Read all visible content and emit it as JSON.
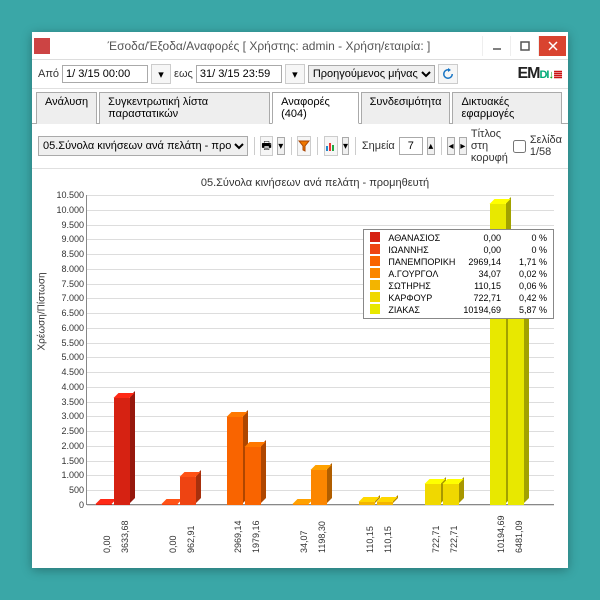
{
  "window": {
    "title": "Έσοδα/Έξοδα/Αναφορές   [ Χρήστης: admin - Χρήση/εταιρία:                                   ]"
  },
  "bar1": {
    "from_label": "Από",
    "from_value": "1/ 3/15 00:00",
    "to_label": "εως",
    "to_value": "31/ 3/15 23:59",
    "period": "Προηγούμενος μήνας"
  },
  "logo": {
    "text": "EMDI"
  },
  "tabs": [
    {
      "label": "Ανάλυση"
    },
    {
      "label": "Συγκεντρωτική λίστα παραστατικών"
    },
    {
      "label": "Αναφορές (404)",
      "active": true
    },
    {
      "label": "Συνδεσιμότητα"
    },
    {
      "label": "Δικτυακές εφαρμογές"
    }
  ],
  "bar2": {
    "report": "05.Σύνολα κινήσεων ανά πελάτη - προ",
    "points_label": "Σημεία",
    "points_value": "7",
    "title_top_label": "Τίτλος στη κορυφή",
    "page_label": "Σελίδα 1/58"
  },
  "chart_title": "05.Σύνολα κινήσεων ανά πελάτη - προμηθευτή",
  "y_axis_label": "Χρέωση/Πίστωση",
  "chart_data": {
    "type": "bar",
    "ylim": [
      0,
      10500
    ],
    "ystep": 500,
    "colors": [
      "#d62212",
      "#ee4412",
      "#f96400",
      "#fb8600",
      "#f3b400",
      "#f0d800",
      "#e8e800"
    ],
    "series": [
      {
        "a": 0.0,
        "b": 3633.68,
        "xa": "0,00",
        "xb": "3633,68"
      },
      {
        "a": 0.0,
        "b": 962.91,
        "xa": "0,00",
        "xb": "962,91"
      },
      {
        "a": 2969.14,
        "b": 1979.16,
        "xa": "2969,14",
        "xb": "1979,16"
      },
      {
        "a": 34.07,
        "b": 1198.3,
        "xa": "34,07",
        "xb": "1198,30"
      },
      {
        "a": 110.15,
        "b": 110.15,
        "xa": "110,15",
        "xb": "110,15"
      },
      {
        "a": 722.71,
        "b": 722.71,
        "xa": "722,71",
        "xb": "722,71"
      },
      {
        "a": 10194.69,
        "b": 6481.09,
        "xa": "10194,69",
        "xb": "6481,09"
      }
    ]
  },
  "legend": [
    {
      "name": "ΑΘΑΝΑΣΙΟΣ",
      "val": "0,00",
      "pct": "0 %"
    },
    {
      "name": "ΙΩΑΝΝΗΣ",
      "val": "0,00",
      "pct": "0 %"
    },
    {
      "name": "ΠΑΝΕΜΠΟΡΙΚΗ",
      "val": "2969,14",
      "pct": "1,71 %"
    },
    {
      "name": "Α.ΓΟΥΡΓΟΛ",
      "val": "34,07",
      "pct": "0,02 %"
    },
    {
      "name": "ΣΩΤΗΡΗΣ",
      "val": "110,15",
      "pct": "0,06 %"
    },
    {
      "name": "ΚΑΡΦΟΥΡ",
      "val": "722,71",
      "pct": "0,42 %"
    },
    {
      "name": "ΖΙΑΚΑΣ",
      "val": "10194,69",
      "pct": "5,87 %"
    }
  ]
}
